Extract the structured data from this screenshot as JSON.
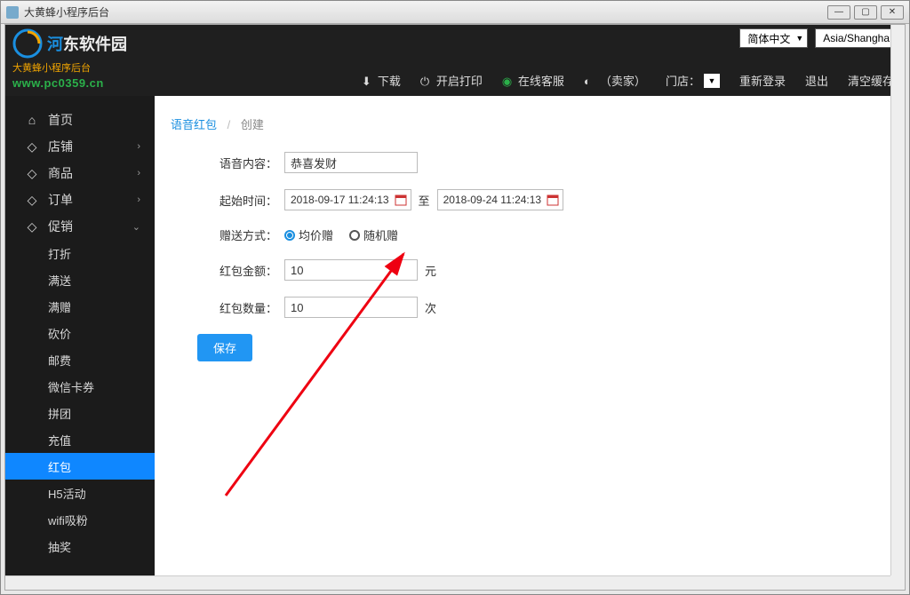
{
  "window": {
    "title": "大黄蜂小程序后台"
  },
  "logo": {
    "line1_a": "河",
    "line1_b": "东软件园",
    "line2": "大黄蜂小程序后台",
    "url": "www.pc0359.cn"
  },
  "top_controls": {
    "lang": "简体中文",
    "tz": "Asia/Shangha"
  },
  "top_links": {
    "download": "下载",
    "print": "开启打印",
    "service": "在线客服",
    "seller": "（卖家）",
    "store": "门店：",
    "relogin": "重新登录",
    "logout": "退出",
    "clear": "清空缓存"
  },
  "sidebar": {
    "top": [
      {
        "label": "首页",
        "chev": ""
      },
      {
        "label": "店铺",
        "chev": "›"
      },
      {
        "label": "商品",
        "chev": "›"
      },
      {
        "label": "订单",
        "chev": "›"
      },
      {
        "label": "促销",
        "chev": "⌄"
      }
    ],
    "subs": [
      {
        "label": "打折",
        "active": false
      },
      {
        "label": "满送",
        "active": false
      },
      {
        "label": "满赠",
        "active": false
      },
      {
        "label": "砍价",
        "active": false
      },
      {
        "label": "邮费",
        "active": false
      },
      {
        "label": "微信卡券",
        "active": false
      },
      {
        "label": "拼团",
        "active": false
      },
      {
        "label": "充值",
        "active": false
      },
      {
        "label": "红包",
        "active": true
      },
      {
        "label": "H5活动",
        "active": false
      },
      {
        "label": "wifi吸粉",
        "active": false
      },
      {
        "label": "抽奖",
        "active": false
      }
    ]
  },
  "breadcrumb": {
    "a": "语音红包",
    "b": "创建"
  },
  "form": {
    "voice_label": "语音内容：",
    "voice_value": "恭喜发财",
    "start_label": "起始时间：",
    "start_value": "2018-09-17 11:24:13",
    "to": "至",
    "end_value": "2018-09-24 11:24:13",
    "give_label": "赠送方式：",
    "give_opt1": "均价赠",
    "give_opt2": "随机赠",
    "amount_label": "红包金额：",
    "amount_value": "10",
    "amount_unit": "元",
    "count_label": "红包数量：",
    "count_value": "10",
    "count_unit": "次",
    "save": "保存"
  }
}
